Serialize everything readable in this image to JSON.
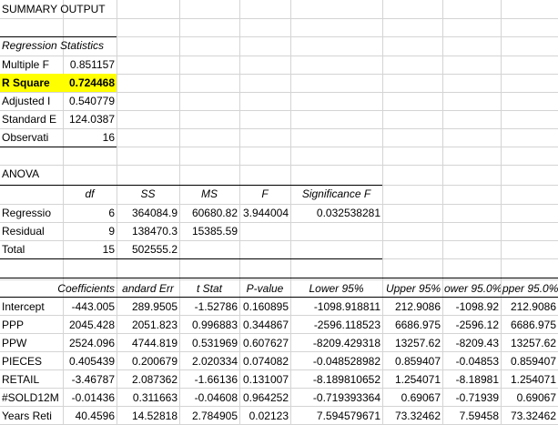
{
  "title": "SUMMARY OUTPUT",
  "highlight_color": "#ffff00",
  "regression_statistics": {
    "header": "Regression Statistics",
    "rows": [
      {
        "label": "Multiple F",
        "value": "0.851157"
      },
      {
        "label": "R Square",
        "value": "0.724468"
      },
      {
        "label": "Adjusted I",
        "value": "0.540779"
      },
      {
        "label": "Standard E",
        "value": "124.0387"
      },
      {
        "label": "Observati",
        "value": "16"
      }
    ]
  },
  "anova": {
    "title": "ANOVA",
    "headers": [
      "df",
      "SS",
      "MS",
      "F",
      "Significance F"
    ],
    "rows": [
      {
        "label": "Regressio",
        "df": "6",
        "ss": "364084.9",
        "ms": "60680.82",
        "f": "3.944004",
        "sig": "0.032538281"
      },
      {
        "label": "Residual",
        "df": "9",
        "ss": "138470.3",
        "ms": "15385.59"
      },
      {
        "label": "Total",
        "df": "15",
        "ss": "502555.2"
      }
    ]
  },
  "coefficients": {
    "headers": [
      "Coefficients",
      "andard Err",
      "t Stat",
      "P-value",
      "Lower 95%",
      "Upper 95%",
      "ower 95.0%",
      "pper 95.0%"
    ],
    "rows": [
      {
        "label": "Intercept",
        "v": [
          "-443.005",
          "289.9505",
          "-1.52786",
          "0.160895",
          "-1098.918811",
          "212.9086",
          "-1098.92",
          "212.9086"
        ]
      },
      {
        "label": "PPP",
        "v": [
          "2045.428",
          "2051.823",
          "0.996883",
          "0.344867",
          "-2596.118523",
          "6686.975",
          "-2596.12",
          "6686.975"
        ]
      },
      {
        "label": "PPW",
        "v": [
          "2524.096",
          "4744.819",
          "0.531969",
          "0.607627",
          "-8209.429318",
          "13257.62",
          "-8209.43",
          "13257.62"
        ]
      },
      {
        "label": "PIECES",
        "v": [
          "0.405439",
          "0.200679",
          "2.020334",
          "0.074082",
          "-0.048528982",
          "0.859407",
          "-0.04853",
          "0.859407"
        ]
      },
      {
        "label": "RETAIL",
        "v": [
          "-3.46787",
          "2.087362",
          "-1.66136",
          "0.131007",
          "-8.189810652",
          "1.254071",
          "-8.18981",
          "1.254071"
        ]
      },
      {
        "label": "#SOLD12M",
        "v": [
          "-0.01436",
          "0.311663",
          "-0.04608",
          "0.964252",
          "-0.719393364",
          "0.69067",
          "-0.71939",
          "0.69067"
        ]
      },
      {
        "label": "Years Reti",
        "v": [
          "40.4596",
          "14.52818",
          "2.784905",
          "0.02123",
          "7.594579671",
          "73.32462",
          "7.59458",
          "73.32462"
        ]
      }
    ]
  }
}
